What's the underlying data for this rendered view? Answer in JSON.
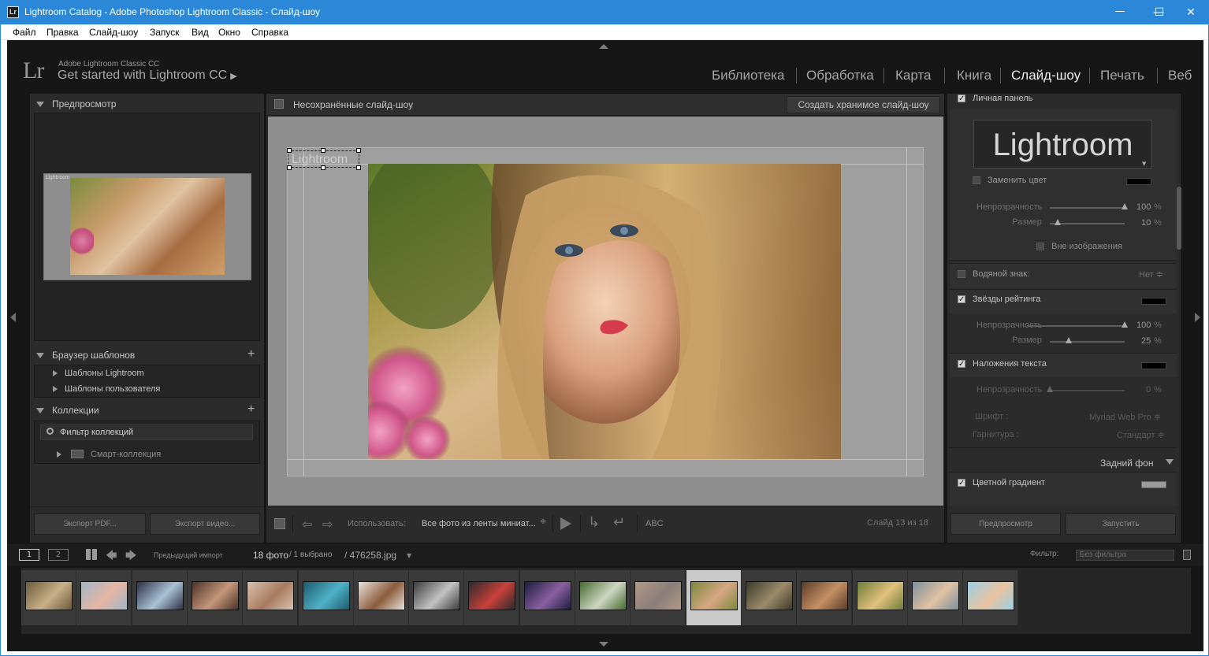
{
  "window": {
    "app_icon": "Lr",
    "title": "Lightroom Catalog - Adobe Photoshop Lightroom Classic - Слайд-шоу",
    "minimize": "—",
    "maximize": "☐",
    "close": "✕"
  },
  "menu": [
    "Файл",
    "Правка",
    "Слайд-шоу",
    "Запуск",
    "Вид",
    "Окно",
    "Справка"
  ],
  "identity": {
    "logo": "Lr",
    "product": "Adobe Lightroom Classic CC",
    "tagline": "Get started with Lightroom CC",
    "tagline_arrow": "▶"
  },
  "modules": [
    {
      "label": "Библиотека",
      "active": false
    },
    {
      "label": "Обработка",
      "active": false
    },
    {
      "label": "Карта",
      "active": false
    },
    {
      "label": "Книга",
      "active": false
    },
    {
      "label": "Слайд-шоу",
      "active": true
    },
    {
      "label": "Печать",
      "active": false
    },
    {
      "label": "Веб",
      "active": false
    }
  ],
  "left_panel": {
    "preview_title": "Предпросмотр",
    "preview_small_text": "Lightroom",
    "template_browser_title": "Браузер шаблонов",
    "templates": [
      "Шаблоны Lightroom",
      "Шаблоны пользователя"
    ],
    "collections_title": "Коллекции",
    "collection_filter": "Фильтр коллекций",
    "smart_collection": "Смарт-коллекция",
    "plus": "+",
    "export_pdf": "Экспорт PDF...",
    "export_video": "Экспорт видео..."
  },
  "center": {
    "slideshow_name": "Несохранённые слайд-шоу",
    "create_button": "Создать хранимое слайд-шоу",
    "identity_plate_text": "Lightroom",
    "toolbar": {
      "use_label": "Использовать:",
      "use_value": "Все фото из ленты миниат...",
      "abc": "ABC",
      "slide_counter": "Слайд 13 из 18"
    }
  },
  "right_panel": {
    "personal_panel": "Личная панель",
    "identity_plate": "Lightroom",
    "replace_color": "Заменить цвет",
    "opacity_label": "Непрозрачность",
    "size_label": "Размер",
    "identity_opacity": "100",
    "identity_size": "10",
    "percent": "%",
    "outside_image": "Вне изображения",
    "watermark_label": "Водяной знак:",
    "watermark_value": "Нет ≑",
    "rating_stars": "Звёзды рейтинга",
    "stars_opacity": "100",
    "stars_size": "25",
    "text_overlays": "Наложения текста",
    "text_opacity": "0",
    "font_label": "Шрифт :",
    "font_value": "Myriad Web Pro ≑",
    "face_label": "Гарнитура :",
    "face_value": "Стандарт ≑",
    "backdrop_title": "Задний фон",
    "color_gradient": "Цветной градиент",
    "preview_button": "Предпросмотр",
    "play_button": "Запустить",
    "levels": {
      "identity_opacity": 1.0,
      "identity_size": 0.1,
      "stars_opacity": 1.0,
      "stars_size": 0.25,
      "text_opacity": 0.0
    }
  },
  "filmstrip_bar": {
    "view1": "1",
    "view2": "2",
    "source": "Предыдущий импорт",
    "count": "18 фото",
    "selected": "/ 1 выбрано",
    "filename": "/ 476258.jpg",
    "filter_label": "Фильтр:",
    "filter_value": "Без фильтра"
  },
  "filmstrip": {
    "selected_index": 12,
    "thumb_colors": [
      [
        "#6b5a3a",
        "#c9b087"
      ],
      [
        "#9fb6c8",
        "#e7b6a4"
      ],
      [
        "#2c2f45",
        "#a9c3d6"
      ],
      [
        "#4a3328",
        "#c7977b"
      ],
      [
        "#d6c2b0",
        "#a87a5f"
      ],
      [
        "#1d5a6c",
        "#4fb2c7"
      ],
      [
        "#e8e2da",
        "#8c5b3c"
      ],
      [
        "#3b3b3b",
        "#c2c2c2"
      ],
      [
        "#2a2a2a",
        "#c9403a"
      ],
      [
        "#1c1c3c",
        "#8a5fa2"
      ],
      [
        "#456b2f",
        "#cfd6c3"
      ],
      [
        "#b39a86",
        "#8b7d7a"
      ],
      [
        "#7d8a3a",
        "#d7a684"
      ],
      [
        "#3c3a2a",
        "#9c8a6a"
      ],
      [
        "#5a3c28",
        "#c59063"
      ],
      [
        "#6d7d3a",
        "#e2c07d"
      ],
      [
        "#7f8f9c",
        "#e0c2a3"
      ],
      [
        "#9bd0e6",
        "#e9c3a0"
      ]
    ]
  }
}
